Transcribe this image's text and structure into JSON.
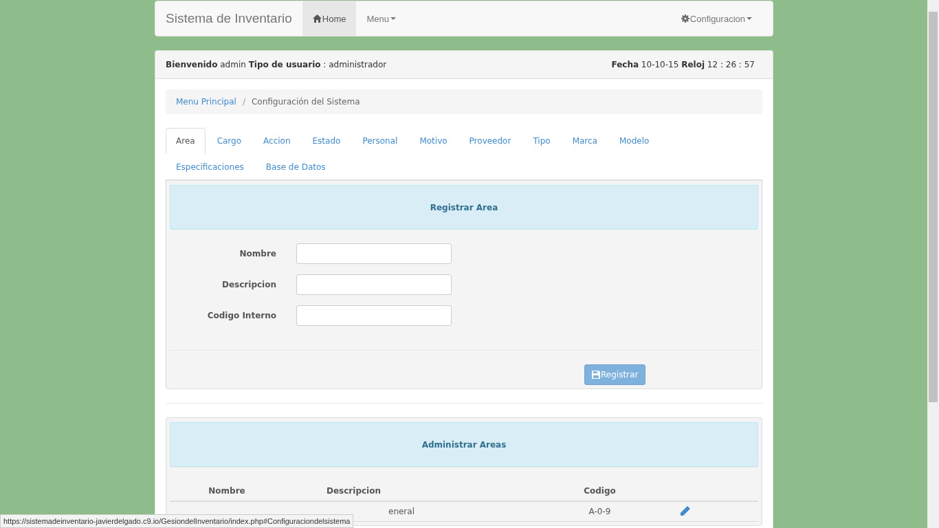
{
  "navbar": {
    "brand": "Sistema de Inventario",
    "items": [
      {
        "label": "Home",
        "kind": "home",
        "selected": true
      },
      {
        "label": "Menu",
        "kind": "dropdown",
        "selected": false
      }
    ],
    "right_item": {
      "label": "Configuracion",
      "kind": "settings"
    }
  },
  "header": [
    {
      "label": "Bienvenido",
      "value": "admin"
    },
    {
      "label": "Tipo de usuario",
      "value": ": administrador"
    }
  ],
  "header_right": [
    {
      "label": "Fecha",
      "value": "10-10-15"
    },
    {
      "label": "Reloj",
      "value": "12 : 26 : 57"
    }
  ],
  "breadcrumb": {
    "separator": "/",
    "items": [
      {
        "label": "Menu Principal",
        "kind": "link"
      },
      {
        "label": "Configuración del Sistema",
        "kind": "current"
      }
    ]
  },
  "tabs": [
    {
      "label": "Area",
      "selected": true
    },
    {
      "label": "Cargo",
      "selected": false
    },
    {
      "label": "Accion",
      "selected": false
    },
    {
      "label": "Estado",
      "selected": false
    },
    {
      "label": "Personal",
      "selected": false
    },
    {
      "label": "Motivo",
      "selected": false
    },
    {
      "label": "Proveedor",
      "selected": false
    },
    {
      "label": "Tipo",
      "selected": false
    },
    {
      "label": "Marca",
      "selected": false
    },
    {
      "label": "Modelo",
      "selected": false
    },
    {
      "label": "Especificaciones",
      "selected": false
    },
    {
      "label": "Base de Datos",
      "selected": false
    }
  ],
  "register": {
    "title": "Registrar Area",
    "fields": [
      {
        "label": "Nombre"
      },
      {
        "label": "Descripcion"
      },
      {
        "label": "Codigo Interno"
      }
    ],
    "button": "Registrar"
  },
  "manage": {
    "title": "Administrar Areas",
    "columns": [
      "Nombre",
      "Descripcion",
      "Codigo"
    ],
    "rows": [
      {
        "cells": [
          "",
          "eneral",
          "A-0-9"
        ],
        "editable": true
      }
    ]
  },
  "status_url": "https://sistemadeinventario-javierdelgado.c9.io/GesiondelInventario/index.php#Configuraciondelsistema"
}
